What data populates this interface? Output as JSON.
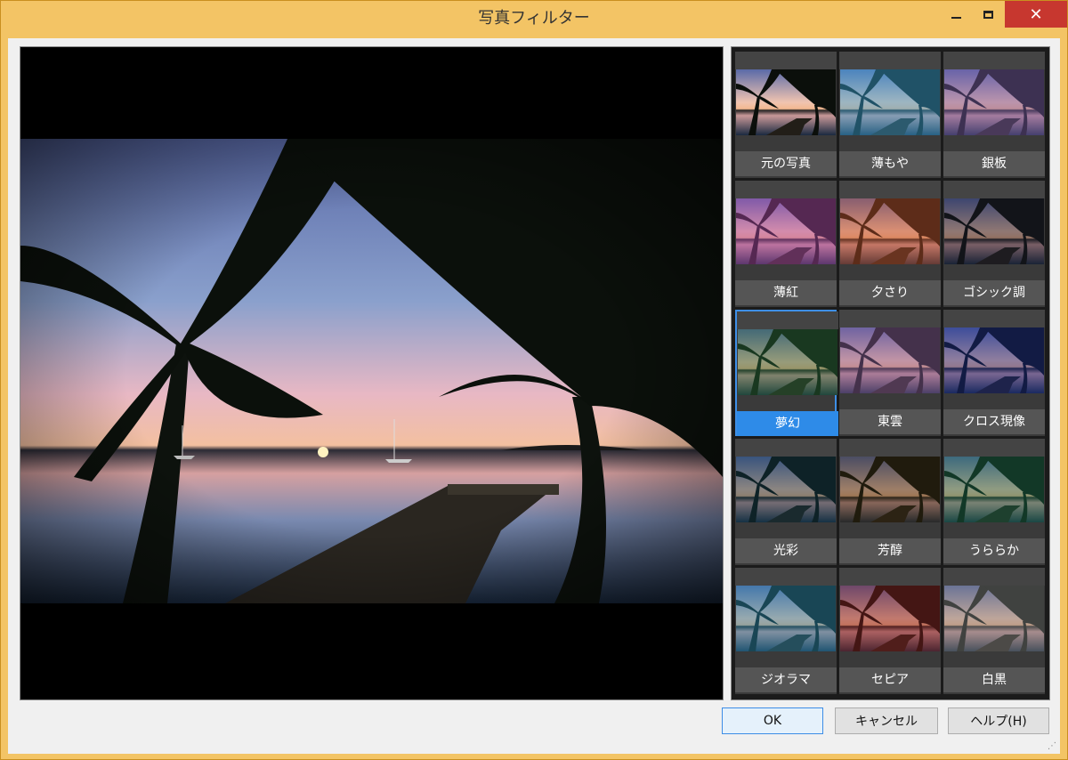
{
  "window": {
    "title": "写真フィルター",
    "controls": {
      "minimize": "minimize-icon",
      "maximize": "maximize-icon",
      "close": "close-icon"
    }
  },
  "filters": [
    {
      "label": "元の写真",
      "tint": "none"
    },
    {
      "label": "薄もや",
      "tint": "#3aa4d6"
    },
    {
      "label": "銀板",
      "tint": "#7a5aa8"
    },
    {
      "label": "薄紅",
      "tint": "#b046a8"
    },
    {
      "label": "夕さり",
      "tint": "#c0502a"
    },
    {
      "label": "ゴシック調",
      "tint": "#1a1a2a"
    },
    {
      "label": "夢幻",
      "tint": "#2a6a3a"
    },
    {
      "label": "東雲",
      "tint": "#8a5a9a"
    },
    {
      "label": "クロス現像",
      "tint": "#1a2a8a"
    },
    {
      "label": "光彩",
      "tint": "#113a4a"
    },
    {
      "label": "芳醇",
      "tint": "#3a2a10"
    },
    {
      "label": "うららか",
      "tint": "#1a6a4a"
    },
    {
      "label": "ジオラマ",
      "tint": "#2a8ab0"
    },
    {
      "label": "セピア",
      "tint": "#8a2020"
    },
    {
      "label": "白黒",
      "tint": "#808080"
    }
  ],
  "selected_filter": "夢幻",
  "buttons": {
    "ok": "OK",
    "cancel": "キャンセル",
    "help": "ヘルプ(H)"
  },
  "colors": {
    "selection": "#2e8be8",
    "titlebar": "#f3c465",
    "close": "#c7372f"
  }
}
